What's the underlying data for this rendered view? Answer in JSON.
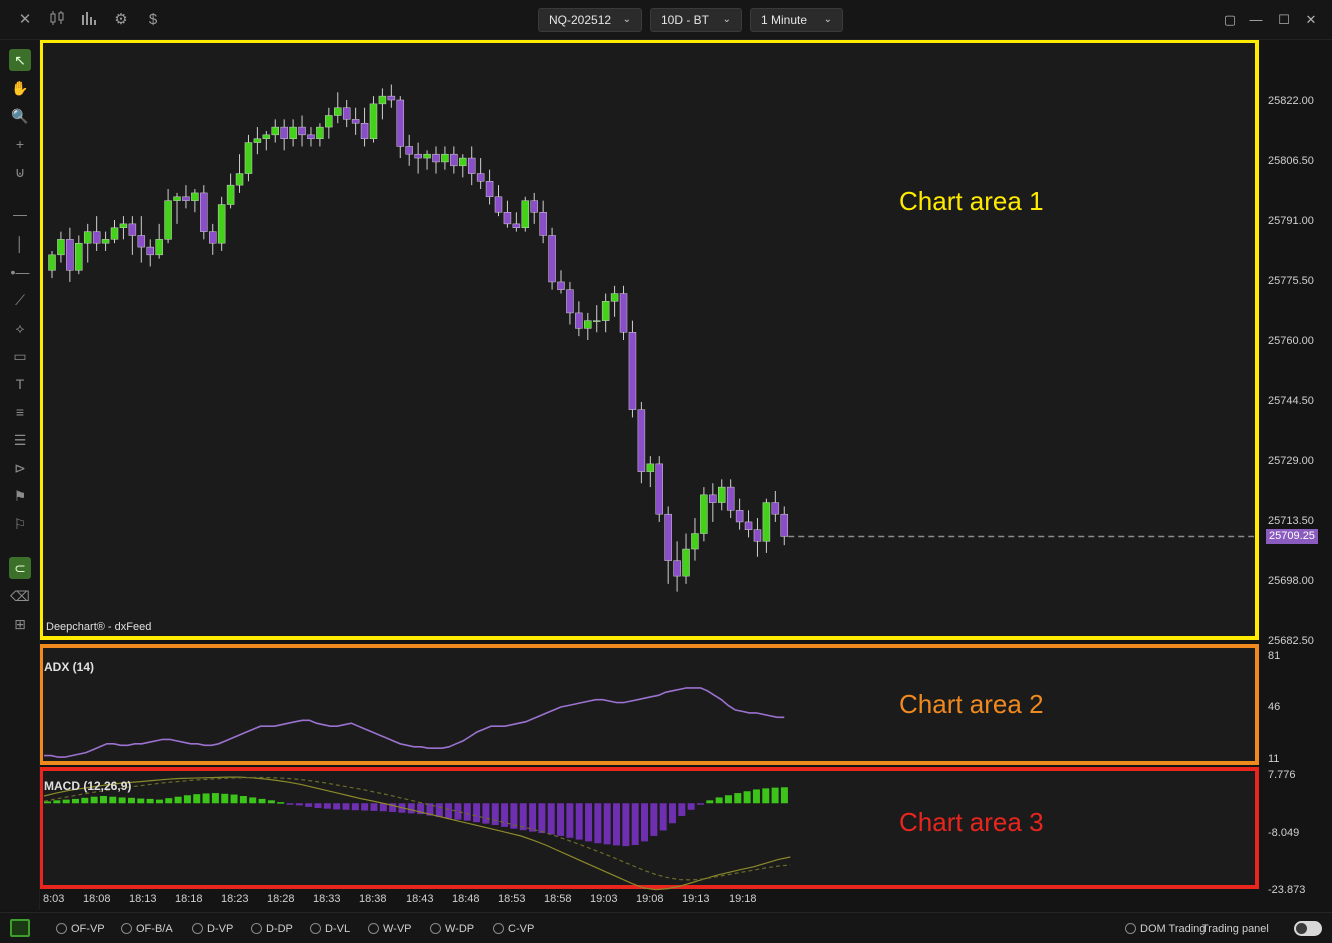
{
  "toolbar_top": {
    "icons": [
      "close-icon",
      "candles-icon",
      "bar-chart-icon",
      "settings-icon",
      "dollar-icon"
    ],
    "symbol": "NQ-202512",
    "range": "10D - BT",
    "interval": "1 Minute"
  },
  "window_controls": [
    "restore-icon",
    "minimize-icon",
    "maximize-icon",
    "close-icon"
  ],
  "drawing_tools": [
    "pointer-icon",
    "hand-icon",
    "zoom-icon",
    "crosshair-icon",
    "magnet-icon",
    "horizontal-line-icon",
    "vertical-line-icon",
    "ray-icon",
    "trendline-icon",
    "polyline-icon",
    "rectangle-icon",
    "text-icon",
    "lines-icon",
    "multi-lines-icon",
    "arrow-tool-icon",
    "price-note-icon",
    "size-note-icon",
    "magnet-lock-icon",
    "eraser-icon",
    "add-layer-icon"
  ],
  "chart": {
    "brand": "Deepchart® - dxFeed",
    "last_price": "25709.25",
    "area_labels": [
      "Chart area 1",
      "Chart area 2",
      "Chart area 3"
    ],
    "area_colors": [
      "#ffeb00",
      "#f08a1f",
      "#e8261e"
    ],
    "adx_label": "ADX (14)",
    "macd_label": "MACD (12,26,9)",
    "price_axis": [
      "25822.00",
      "25806.50",
      "25791.00",
      "25775.50",
      "25760.00",
      "25744.50",
      "25729.00",
      "25713.50",
      "25698.00",
      "25682.50"
    ],
    "adx_axis": [
      "81",
      "46",
      "11"
    ],
    "macd_axis": [
      "7.776",
      "-8.049",
      "-23.873"
    ],
    "time_axis": [
      "8:03",
      "18:08",
      "18:13",
      "18:18",
      "18:23",
      "18:28",
      "18:33",
      "18:38",
      "18:43",
      "18:48",
      "18:53",
      "18:58",
      "19:03",
      "19:08",
      "19:13",
      "19:18"
    ]
  },
  "chart_data": {
    "type": "candlestick",
    "up_color": "#44d11a",
    "down_color": "#8a4fc8",
    "candles_ohlc": [
      [
        25778,
        25783,
        25776,
        25782
      ],
      [
        25782,
        25788,
        25780,
        25786
      ],
      [
        25786,
        25789,
        25775,
        25778
      ],
      [
        25778,
        25787,
        25777,
        25785
      ],
      [
        25785,
        25790,
        25780,
        25788
      ],
      [
        25788,
        25792,
        25783,
        25785
      ],
      [
        25785,
        25788,
        25783,
        25786
      ],
      [
        25786,
        25791,
        25785,
        25789
      ],
      [
        25789,
        25792,
        25786,
        25790
      ],
      [
        25790,
        25792,
        25782,
        25787
      ],
      [
        25787,
        25792,
        25780,
        25784
      ],
      [
        25784,
        25786,
        25779,
        25782
      ],
      [
        25782,
        25790,
        25781,
        25786
      ],
      [
        25786,
        25799,
        25785,
        25796
      ],
      [
        25796,
        25798,
        25790,
        25797
      ],
      [
        25797,
        25800,
        25794,
        25796
      ],
      [
        25796,
        25799,
        25793,
        25798
      ],
      [
        25798,
        25800,
        25786,
        25788
      ],
      [
        25788,
        25790,
        25782,
        25785
      ],
      [
        25785,
        25797,
        25783,
        25795
      ],
      [
        25795,
        25803,
        25794,
        25800
      ],
      [
        25800,
        25808,
        25798,
        25803
      ],
      [
        25803,
        25813,
        25801,
        25811
      ],
      [
        25811,
        25815,
        25808,
        25812
      ],
      [
        25812,
        25814,
        25809,
        25813
      ],
      [
        25813,
        25817,
        25811,
        25815
      ],
      [
        25815,
        25817,
        25809,
        25812
      ],
      [
        25812,
        25817,
        25810,
        25815
      ],
      [
        25815,
        25818,
        25810,
        25813
      ],
      [
        25813,
        25815,
        25810,
        25812
      ],
      [
        25812,
        25816,
        25810,
        25815
      ],
      [
        25815,
        25820,
        25812,
        25818
      ],
      [
        25818,
        25824,
        25816,
        25820
      ],
      [
        25820,
        25822,
        25815,
        25817
      ],
      [
        25817,
        25820,
        25813,
        25816
      ],
      [
        25816,
        25820,
        25810,
        25812
      ],
      [
        25812,
        25823,
        25811,
        25821
      ],
      [
        25821,
        25825,
        25817,
        25823
      ],
      [
        25823,
        25826,
        25820,
        25822
      ],
      [
        25822,
        25823,
        25807,
        25810
      ],
      [
        25810,
        25813,
        25805,
        25808
      ],
      [
        25808,
        25811,
        25803,
        25807
      ],
      [
        25807,
        25809,
        25804,
        25808
      ],
      [
        25808,
        25810,
        25803,
        25806
      ],
      [
        25806,
        25810,
        25804,
        25808
      ],
      [
        25808,
        25810,
        25803,
        25805
      ],
      [
        25805,
        25808,
        25802,
        25807
      ],
      [
        25807,
        25810,
        25800,
        25803
      ],
      [
        25803,
        25807,
        25799,
        25801
      ],
      [
        25801,
        25804,
        25795,
        25797
      ],
      [
        25797,
        25800,
        25792,
        25793
      ],
      [
        25793,
        25796,
        25789,
        25790
      ],
      [
        25790,
        25793,
        25788,
        25789
      ],
      [
        25789,
        25797,
        25788,
        25796
      ],
      [
        25796,
        25798,
        25790,
        25793
      ],
      [
        25793,
        25796,
        25785,
        25787
      ],
      [
        25787,
        25789,
        25773,
        25775
      ],
      [
        25775,
        25778,
        25772,
        25773
      ],
      [
        25773,
        25775,
        25764,
        25767
      ],
      [
        25767,
        25770,
        25761,
        25763
      ],
      [
        25763,
        25767,
        25760,
        25765
      ],
      [
        25765,
        25769,
        25762,
        25765
      ],
      [
        25765,
        25772,
        25762,
        25770
      ],
      [
        25770,
        25774,
        25766,
        25772
      ],
      [
        25772,
        25774,
        25760,
        25762
      ],
      [
        25762,
        25765,
        25740,
        25742
      ],
      [
        25742,
        25744,
        25723,
        25726
      ],
      [
        25726,
        25730,
        25722,
        25728
      ],
      [
        25728,
        25730,
        25713,
        25715
      ],
      [
        25715,
        25717,
        25697,
        25703
      ],
      [
        25703,
        25708,
        25695,
        25699
      ],
      [
        25699,
        25710,
        25697,
        25706
      ],
      [
        25706,
        25714,
        25703,
        25710
      ],
      [
        25710,
        25722,
        25708,
        25720
      ],
      [
        25720,
        25723,
        25713,
        25718
      ],
      [
        25718,
        25724,
        25716,
        25722
      ],
      [
        25722,
        25724,
        25714,
        25716
      ],
      [
        25716,
        25719,
        25711,
        25713
      ],
      [
        25713,
        25716,
        25709,
        25711
      ],
      [
        25711,
        25714,
        25704,
        25708
      ],
      [
        25708,
        25719,
        25705,
        25718
      ],
      [
        25718,
        25721,
        25713,
        25715
      ],
      [
        25715,
        25717,
        25707,
        25709.25
      ]
    ],
    "adx_values": [
      14,
      14,
      13,
      13,
      14,
      15,
      16,
      18,
      20,
      22,
      22,
      21,
      21,
      22,
      22,
      23,
      24,
      25,
      25,
      24,
      23,
      22,
      22,
      21,
      21,
      22,
      24,
      26,
      28,
      30,
      32,
      34,
      34,
      34,
      35,
      36,
      37,
      38,
      38,
      36,
      35,
      34,
      34,
      35,
      36,
      34,
      32,
      30,
      28,
      26,
      24,
      22,
      21,
      20,
      20,
      19,
      19,
      19,
      20,
      22,
      24,
      27,
      30,
      32,
      34,
      34,
      34,
      35,
      36,
      37,
      39,
      41,
      43,
      45,
      47,
      48,
      49,
      50,
      51,
      52,
      52,
      51,
      50,
      50,
      51,
      52,
      53,
      54,
      55,
      57,
      58,
      59,
      60,
      60,
      60,
      58,
      55,
      52,
      48,
      45,
      44,
      43,
      43,
      42,
      41,
      40,
      40
    ],
    "macd_hist": [
      0.5,
      0.8,
      1,
      1.2,
      1.5,
      1.8,
      2,
      1.8,
      1.6,
      1.5,
      1.3,
      1.2,
      1,
      1.4,
      1.8,
      2.2,
      2.5,
      2.7,
      2.8,
      2.6,
      2.4,
      2,
      1.6,
      1.2,
      0.8,
      0.3,
      -0.2,
      -0.6,
      -1,
      -1.3,
      -1.5,
      -1.7,
      -1.8,
      -1.9,
      -2,
      -2.1,
      -2.2,
      -2.4,
      -2.6,
      -2.8,
      -3,
      -3.4,
      -3.8,
      -4.2,
      -4.5,
      -4.8,
      -5.2,
      -5.6,
      -6,
      -6.5,
      -7,
      -7.4,
      -7.8,
      -8.2,
      -8.6,
      -9,
      -9.5,
      -10,
      -10.5,
      -11,
      -11.3,
      -11.6,
      -11.8,
      -11.5,
      -10.5,
      -9,
      -7.5,
      -5.5,
      -3.5,
      -1.8,
      -0.3,
      0.8,
      1.6,
      2.2,
      2.8,
      3.3,
      3.8,
      4.1,
      4.3,
      4.4
    ],
    "macd_line": [
      2,
      2.8,
      3.5,
      4,
      4.5,
      5,
      5.4,
      5.7,
      6,
      6.3,
      6.6,
      6.8,
      6.9,
      7,
      7.1,
      7.2,
      7.2,
      7,
      6.7,
      6.3,
      5.8,
      5.2,
      4.4,
      3.6,
      2.8,
      2,
      1.2,
      0.5,
      -0.2,
      -1,
      -1.8,
      -2.6,
      -3.4,
      -4.2,
      -5,
      -5.8,
      -6.6,
      -7.4,
      -8.2,
      -9,
      -10.2,
      -11.5,
      -13,
      -14.5,
      -16,
      -17.5,
      -19,
      -20.5,
      -22,
      -23.3,
      -23.8,
      -23.5,
      -22.8,
      -21.8,
      -20.8,
      -19.8,
      -19,
      -18.2,
      -17.5,
      -16.5,
      -15.5,
      -14.8
    ],
    "macd_signal": [
      0.5,
      1.2,
      1.8,
      2.4,
      3,
      3.5,
      4,
      4.5,
      4.9,
      5.3,
      5.7,
      6,
      6.3,
      6.5,
      6.7,
      6.9,
      7,
      7.1,
      7.1,
      7,
      6.8,
      6.5,
      6.1,
      5.6,
      5,
      4.4,
      3.8,
      3.1,
      2.4,
      1.6,
      0.8,
      0,
      -0.8,
      -1.6,
      -2.4,
      -3.2,
      -4,
      -4.8,
      -5.6,
      -6.4,
      -7.2,
      -8.1,
      -9.2,
      -10.4,
      -11.6,
      -12.9,
      -14.2,
      -15.6,
      -17,
      -18.4,
      -19.6,
      -20.5,
      -21,
      -21.1,
      -20.8,
      -20.2,
      -19.6,
      -19,
      -18.4,
      -17.8,
      -17.3,
      -17
    ]
  },
  "bottombar": {
    "items": [
      "OF-VP",
      "OF-B/A",
      "D-VP",
      "D-DP",
      "D-VL",
      "W-VP",
      "W-DP",
      "C-VP"
    ],
    "dom_trading": "DOM Trading",
    "trading_panel": "Trading panel"
  }
}
